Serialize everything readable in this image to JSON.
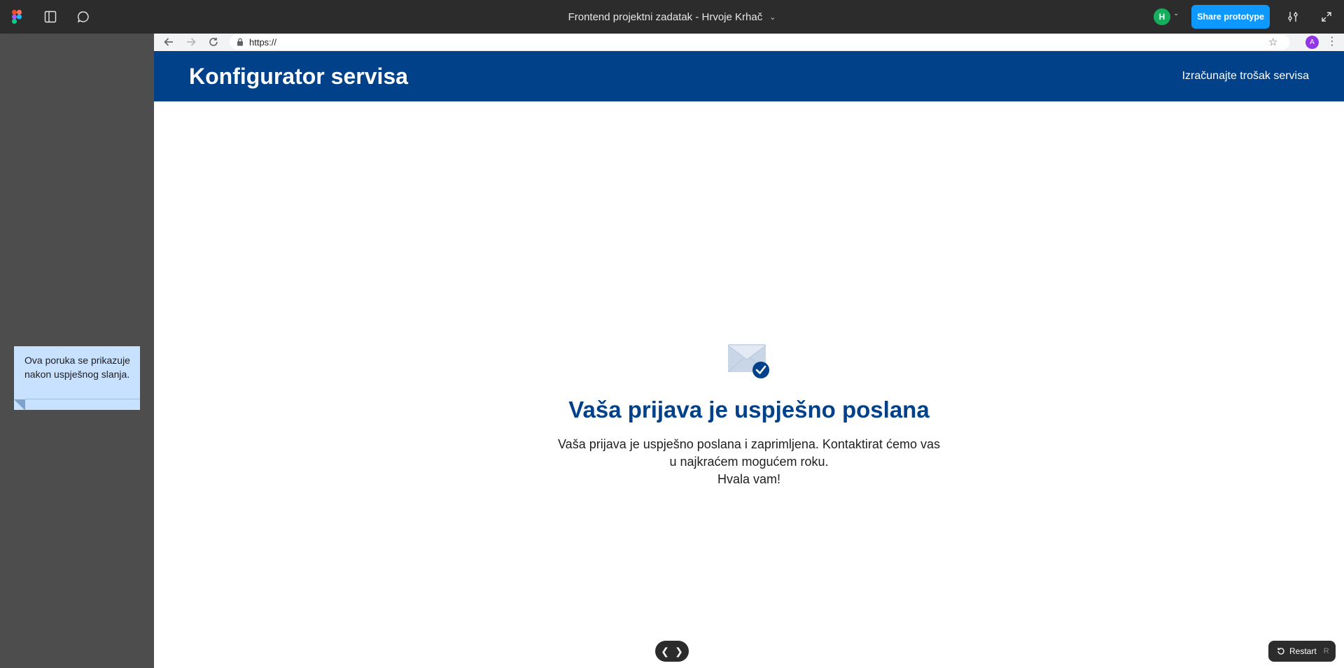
{
  "figma": {
    "title": "Frontend projektni zadatak - Hrvoje Krhač",
    "user_initial": "H",
    "share_label": "Share prototype",
    "restart_label": "Restart",
    "restart_shortcut": "R",
    "icons": [
      "figma-logo-icon",
      "sidebar-toggle-icon",
      "comment-icon",
      "settings-sliders-icon",
      "expand-icon",
      "restart-icon",
      "prev-arrow-icon",
      "next-arrow-icon"
    ],
    "colors": {
      "toolbar": "#2c2c2c",
      "share": "#0d99ff",
      "avatar": "#14ae5c"
    }
  },
  "sticky_note": {
    "text": "Ova poruka se prikazuje nakon uspješnog slanja.",
    "color": "#c7e1ff"
  },
  "browser": {
    "url": "https://",
    "profile_initial": "A",
    "colors": {
      "profile": "#9334e6"
    }
  },
  "site": {
    "title": "Konfigurator servisa",
    "nav_link": "Izračunajte trošak servisa",
    "colors": {
      "header": "#00418a",
      "headline": "#00418a"
    }
  },
  "success": {
    "icon": "mail-check-icon",
    "headline": "Vaša prijava je uspješno poslana",
    "line1": "Vaša prijava je uspješno poslana i zaprimljena. Kontaktirat ćemo vas",
    "line2": "u najkraćem mogućem roku.",
    "line3": "Hvala vam!"
  }
}
